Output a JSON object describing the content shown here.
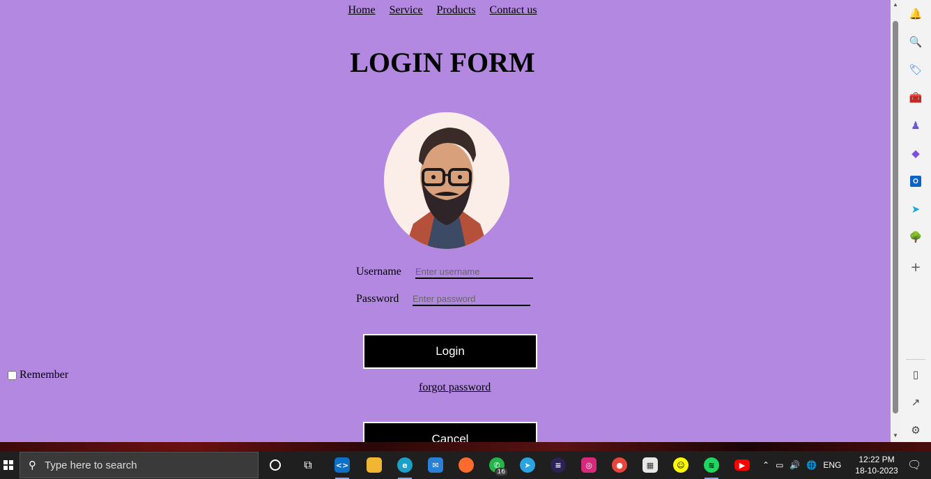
{
  "nav": {
    "items": [
      "Home",
      "Service",
      "Products",
      "Contact us"
    ]
  },
  "page": {
    "title": "LOGIN FORM"
  },
  "form": {
    "username_label": "Username",
    "username_placeholder": "Enter username",
    "password_label": "Password",
    "password_placeholder": "Enter password",
    "login_label": "Login",
    "remember_label": "Remember",
    "forgot_label": "forgot password",
    "cancel_label": "Cancel"
  },
  "colors": {
    "page_background": "#b388e0",
    "button_background": "#000000",
    "button_text": "#ffffff"
  },
  "edge_sidebar": {
    "icons": [
      "bell-icon",
      "search-icon",
      "tag-icon",
      "toolbox-icon",
      "chess-icon",
      "copilot-icon",
      "outlook-icon",
      "send-icon",
      "tree-icon",
      "plus-icon",
      "sidebar-icon",
      "external-icon",
      "settings-icon"
    ]
  },
  "taskbar": {
    "search_placeholder": "Type here to search",
    "whatsapp_badge": "16",
    "language": "ENG",
    "time": "12:22 PM",
    "date": "18-10-2023"
  }
}
